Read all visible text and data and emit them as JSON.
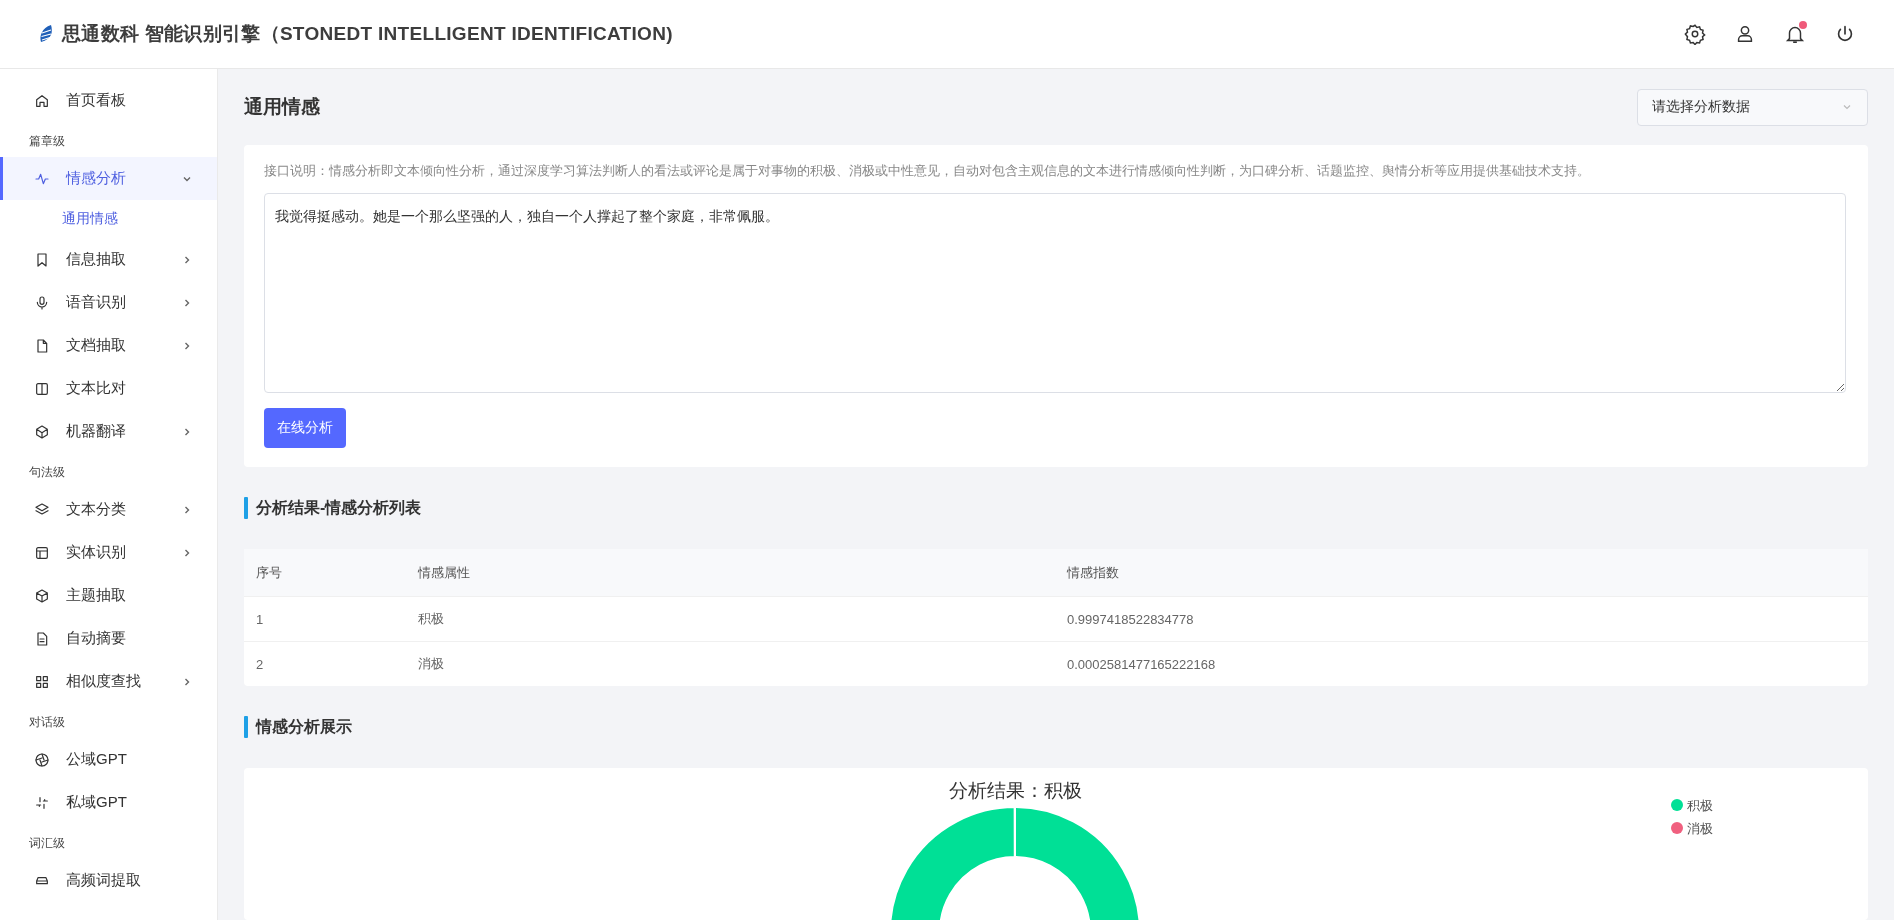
{
  "header": {
    "title": "思通数科 智能识别引擎（STONEDT INTELLIGENT IDENTIFICATION)",
    "notification_dot": true
  },
  "sidebar": {
    "top_items": [
      {
        "label": "首页看板",
        "kind": "link",
        "selected": false
      }
    ],
    "groups": [
      {
        "label": "篇章级",
        "items": [
          {
            "label": "情感分析",
            "kind": "submenu",
            "selected": true,
            "expanded": true,
            "children": [
              {
                "label": "通用情感",
                "selected": true
              }
            ]
          },
          {
            "label": "信息抽取",
            "kind": "submenu",
            "selected": false,
            "expanded": false
          },
          {
            "label": "语音识别",
            "kind": "submenu",
            "selected": false,
            "expanded": false
          },
          {
            "label": "文档抽取",
            "kind": "submenu",
            "selected": false,
            "expanded": false
          },
          {
            "label": "文本比对",
            "kind": "link",
            "selected": false
          },
          {
            "label": "机器翻译",
            "kind": "submenu",
            "selected": false,
            "expanded": false
          }
        ]
      },
      {
        "label": "句法级",
        "items": [
          {
            "label": "文本分类",
            "kind": "submenu",
            "selected": false,
            "expanded": false
          },
          {
            "label": "实体识别",
            "kind": "submenu",
            "selected": false,
            "expanded": false
          },
          {
            "label": "主题抽取",
            "kind": "link",
            "selected": false
          },
          {
            "label": "自动摘要",
            "kind": "link",
            "selected": false
          },
          {
            "label": "相似度查找",
            "kind": "submenu",
            "selected": false,
            "expanded": false
          }
        ]
      },
      {
        "label": "对话级",
        "items": [
          {
            "label": "公域GPT",
            "kind": "link",
            "selected": false
          },
          {
            "label": "私域GPT",
            "kind": "link",
            "selected": false
          }
        ]
      },
      {
        "label": "词汇级",
        "items": [
          {
            "label": "高频词提取",
            "kind": "link",
            "selected": false
          }
        ]
      }
    ]
  },
  "page": {
    "title": "通用情感",
    "data_select": {
      "placeholder": "请选择分析数据"
    },
    "description": "接口说明：情感分析即文本倾向性分析，通过深度学习算法判断人的看法或评论是属于对事物的积极、消极或中性意见，自动对包含主观信息的文本进行情感倾向性判断，为口碑分析、话题监控、舆情分析等应用提供基础技术支持。",
    "input_text": {
      "value": "我觉得挺感动。她是一个那么坚强的人，独自一个人撑起了整个家庭，非常佩服。"
    },
    "analyze_button": "在线分析"
  },
  "results": {
    "title": "分析结果-情感分析列表",
    "table": {
      "columns": [
        "序号",
        "情感属性",
        "情感指数"
      ],
      "rows": [
        [
          "1",
          "积极",
          "0.9997418522834778"
        ],
        [
          "2",
          "消极",
          "0.0002581477165222168"
        ]
      ]
    }
  },
  "display": {
    "title": "情感分析展示",
    "chart_data": {
      "type": "donut",
      "title": "分析结果：积极",
      "legend": true,
      "categories": [
        "积极",
        "消极"
      ],
      "values": [
        0.9997418522834778,
        0.0002581477165222168
      ],
      "colors": [
        "#00e096",
        "#f0607f"
      ]
    }
  }
}
